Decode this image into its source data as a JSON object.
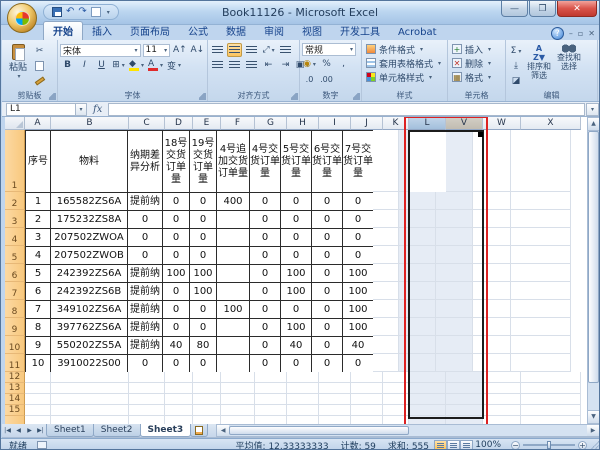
{
  "window": {
    "title": "Book11126 - Microsoft Excel"
  },
  "ribbon": {
    "tabs": [
      {
        "id": "home",
        "label": "开始",
        "active": true
      },
      {
        "id": "insert",
        "label": "插入"
      },
      {
        "id": "page-layout",
        "label": "页面布局"
      },
      {
        "id": "formulas",
        "label": "公式"
      },
      {
        "id": "data",
        "label": "数据"
      },
      {
        "id": "review",
        "label": "审阅"
      },
      {
        "id": "view",
        "label": "视图"
      },
      {
        "id": "developer",
        "label": "开发工具"
      },
      {
        "id": "acrobat",
        "label": "Acrobat"
      }
    ],
    "clipboard": {
      "paste_label": "粘贴",
      "group_label": "剪贴板"
    },
    "font": {
      "name": "宋体",
      "size": "11",
      "bold": "B",
      "italic": "I",
      "underline": "U",
      "pinyin": "变",
      "group_label": "字体"
    },
    "alignment": {
      "group_label": "对齐方式"
    },
    "number": {
      "format": "常规",
      "percent": "%",
      "comma": ",",
      "inc_decimal": ".0",
      "dec_decimal": ".00",
      "group_label": "数字"
    },
    "styles": {
      "conditional": "条件格式",
      "format_as_table": "套用表格格式",
      "cell_styles": "单元格样式",
      "group_label": "样式"
    },
    "cells": {
      "insert": "插入",
      "delete": "删除",
      "format": "格式",
      "group_label": "单元格"
    },
    "editing": {
      "autosum": "Σ",
      "sort_filter": "排序和筛选",
      "find_select": "查找和选择",
      "group_label": "编辑"
    }
  },
  "formula_bar": {
    "name_box": "L1",
    "fx": "fx",
    "formula": ""
  },
  "sheet": {
    "visible_columns": [
      "A",
      "B",
      "C",
      "D",
      "E",
      "F",
      "G",
      "H",
      "I",
      "J",
      "K",
      "L",
      "V",
      "W",
      "X"
    ],
    "selected_columns": [
      "L",
      "V"
    ],
    "active_cell": "L1",
    "annotation_color": "#dd2222",
    "row_numbers": [
      "1",
      "2",
      "3",
      "4",
      "5",
      "6",
      "7",
      "8",
      "9",
      "10",
      "11",
      "12",
      "13",
      "14",
      "15"
    ],
    "header_row": [
      "序号",
      "物料",
      "纳期差异分析",
      "18号交货订单量",
      "19号交货订单量",
      "4号追加交货订单量",
      "4号交货订单量",
      "5号交货订单量",
      "6号交货订单量",
      "7号交货订单量"
    ],
    "data": [
      [
        "1",
        "165582ZS6A",
        "提前纳",
        "0",
        "0",
        "400",
        "0",
        "0",
        "0",
        "0"
      ],
      [
        "2",
        "175232ZS8A",
        "0",
        "0",
        "0",
        "",
        "0",
        "0",
        "0",
        "0"
      ],
      [
        "3",
        "207502ZWOA",
        "0",
        "0",
        "0",
        "",
        "0",
        "0",
        "0",
        "0"
      ],
      [
        "4",
        "207502ZWOB",
        "0",
        "0",
        "0",
        "",
        "0",
        "0",
        "0",
        "0"
      ],
      [
        "5",
        "242392ZS6A",
        "提前纳",
        "100",
        "100",
        "",
        "0",
        "100",
        "0",
        "100"
      ],
      [
        "6",
        "242392ZS6B",
        "提前纳",
        "0",
        "100",
        "",
        "0",
        "100",
        "0",
        "100"
      ],
      [
        "7",
        "349102ZS6A",
        "提前纳",
        "0",
        "0",
        "100",
        "0",
        "0",
        "0",
        "100"
      ],
      [
        "8",
        "397762ZS6A",
        "提前纳",
        "0",
        "0",
        "",
        "0",
        "100",
        "0",
        "100"
      ],
      [
        "9",
        "550202ZS5A",
        "提前纳",
        "40",
        "80",
        "",
        "0",
        "40",
        "0",
        "40"
      ],
      [
        "10",
        "3910022S00",
        "0",
        "0",
        "0",
        "",
        "0",
        "0",
        "0",
        "0"
      ]
    ]
  },
  "sheet_tabs": {
    "tabs": [
      {
        "id": "sheet1",
        "label": "Sheet1"
      },
      {
        "id": "sheet2",
        "label": "Sheet2"
      },
      {
        "id": "sheet3",
        "label": "Sheet3",
        "active": true
      }
    ]
  },
  "status_bar": {
    "mode": "就绪",
    "average": "平均值: 12.33333333",
    "count": "计数: 59",
    "sum": "求和: 555",
    "zoom": "100%"
  }
}
